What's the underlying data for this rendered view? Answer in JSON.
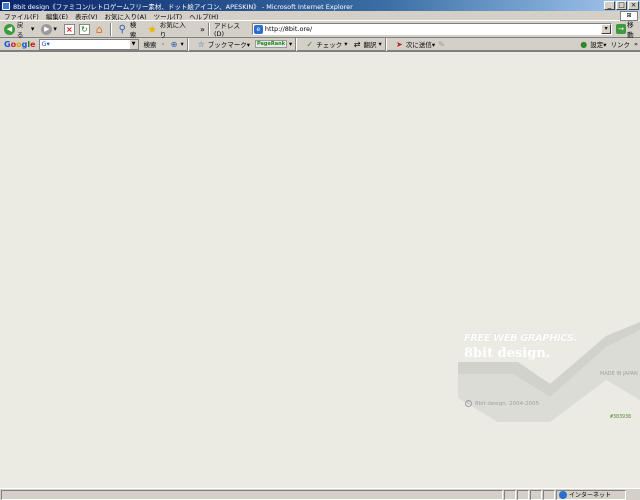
{
  "window": {
    "title": "8bit design《ファミコン/レトロゲームフリー素材、ドット絵アイコン、APESKIN》 - Microsoft Internet Explorer",
    "controls": {
      "minimize": "_",
      "maximize": "□",
      "close": "×"
    }
  },
  "menubar": {
    "items": [
      {
        "label": "ファイル(F)"
      },
      {
        "label": "編集(E)"
      },
      {
        "label": "表示(V)"
      },
      {
        "label": "お気に入り(A)"
      },
      {
        "label": "ツール(T)"
      },
      {
        "label": "ヘルプ(H)"
      }
    ]
  },
  "toolbar": {
    "back_label": "戻る",
    "search_label": "検索",
    "favorites_label": "お気に入り",
    "more_chevron": "»",
    "address_label": "アドレス(D)",
    "address_value": "http://8bit.ore/",
    "go_label": "移動"
  },
  "googlebar": {
    "search_placeholder": "G▾",
    "search_label": "検索",
    "bookmarks_label": "ブックマーク▾",
    "pagerank_label": "PageRank",
    "check_label": "チェック",
    "translate_label": "翻訳",
    "send_label": "次に送信▾",
    "settings_label": "設定▾",
    "links_label": "リンク"
  },
  "page": {
    "logo_line1": "FREE WEB GRAPHICS.",
    "logo_line2": "8bit design.",
    "made_in": "MADE IN JAPAN",
    "copyright": "8bit design. 2004-2005",
    "color_code": "#383938"
  },
  "statusbar": {
    "zone_label": "インターネット"
  },
  "colors": {
    "titlebar_start": "#0a246a",
    "content_bg": "#ebebe4",
    "chrome": "#d4d0c8"
  }
}
